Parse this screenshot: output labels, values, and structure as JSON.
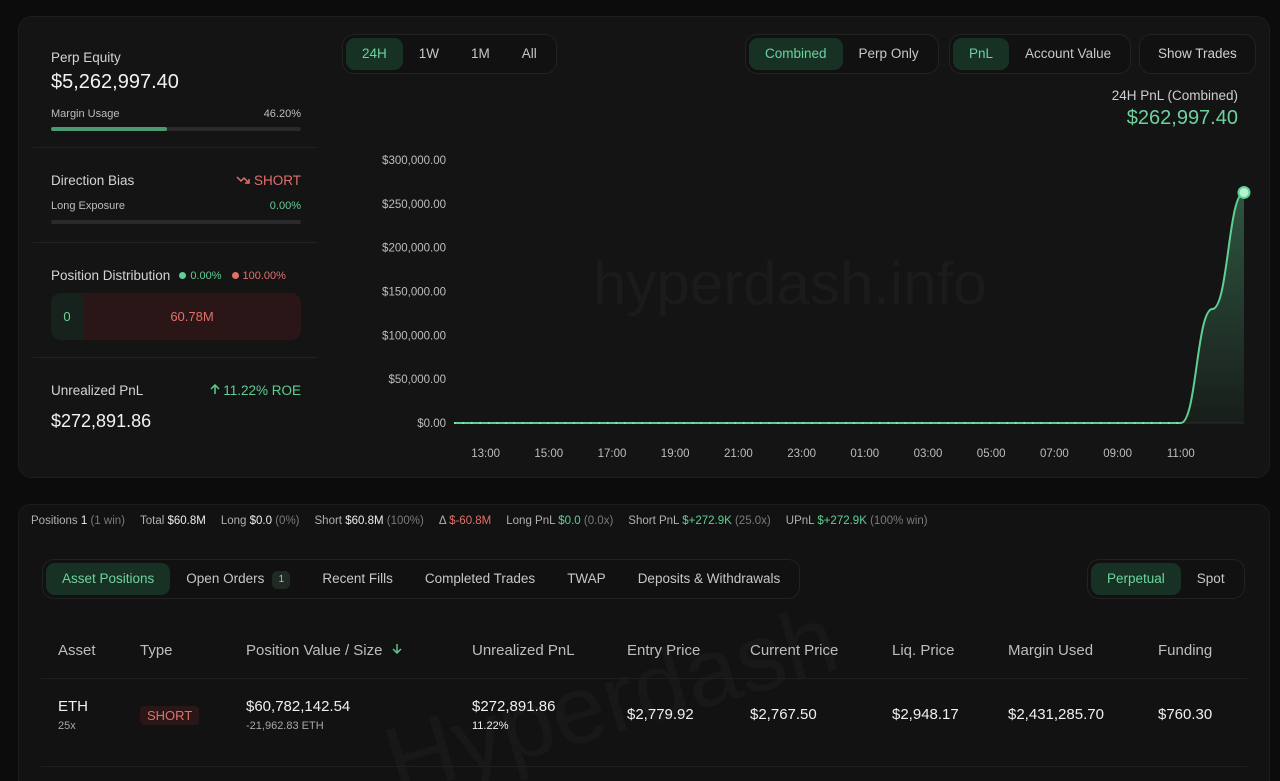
{
  "summary": {
    "perp_equity_label": "Perp Equity",
    "perp_equity_value": "$5,262,997.40",
    "margin_usage_label": "Margin Usage",
    "margin_usage_value": "46.20%",
    "margin_usage_fraction": 0.462,
    "direction_bias_label": "Direction Bias",
    "direction_bias_value": "SHORT",
    "long_exposure_label": "Long Exposure",
    "long_exposure_value": "0.00%",
    "long_exposure_fraction": 0,
    "position_distribution_label": "Position Distribution",
    "dist_long_pct": "0.00%",
    "dist_short_pct": "100.00%",
    "dist_long_value": "0",
    "dist_short_value": "60.78M",
    "unrealized_pnl_label": "Unrealized PnL",
    "roe_value": "11.22% ROE",
    "unrealized_pnl_value": "$272,891.86"
  },
  "controls": {
    "range_tabs": [
      "24H",
      "1W",
      "1M",
      "All"
    ],
    "range_active": "24H",
    "scope_tabs": [
      "Combined",
      "Perp Only"
    ],
    "scope_active": "Combined",
    "metric_tabs": [
      "PnL",
      "Account Value"
    ],
    "metric_active": "PnL",
    "show_trades_label": "Show Trades"
  },
  "chart_header": {
    "label": "24H PnL (Combined)",
    "value": "$262,997.40"
  },
  "watermark": "hyperdash.info",
  "watermark2": "Hyperdash",
  "chart_data": {
    "type": "area",
    "x": [
      "12:00",
      "13:00",
      "14:00",
      "15:00",
      "16:00",
      "17:00",
      "18:00",
      "19:00",
      "20:00",
      "21:00",
      "22:00",
      "23:00",
      "00:00",
      "01:00",
      "02:00",
      "03:00",
      "04:00",
      "05:00",
      "06:00",
      "07:00",
      "08:00",
      "09:00",
      "10:00",
      "11:00",
      "11:30",
      "12:00"
    ],
    "y": [
      0,
      0,
      0,
      0,
      0,
      0,
      0,
      0,
      0,
      0,
      0,
      0,
      0,
      0,
      0,
      0,
      0,
      0,
      0,
      0,
      0,
      0,
      0,
      0,
      130000,
      262997.4
    ],
    "xtick_labels": [
      "13:00",
      "15:00",
      "17:00",
      "19:00",
      "21:00",
      "23:00",
      "01:00",
      "03:00",
      "05:00",
      "07:00",
      "09:00",
      "11:00"
    ],
    "ytick_labels": [
      "$300,000.00",
      "$250,000.00",
      "$200,000.00",
      "$150,000.00",
      "$100,000.00",
      "$50,000.00",
      "$0.00"
    ],
    "ytick_values": [
      300000,
      250000,
      200000,
      150000,
      100000,
      50000,
      0
    ],
    "ylim": [
      0,
      300000
    ],
    "line_color": "#5fcf93",
    "grid": false
  },
  "stats": [
    {
      "label": "Positions",
      "value": "1",
      "muted": "(1 win)",
      "tone": "plain"
    },
    {
      "label": "Total",
      "value": "$60.8M",
      "muted": "",
      "tone": "plain"
    },
    {
      "label": "Long",
      "value": "$0.0",
      "muted": "(0%)",
      "tone": "plain"
    },
    {
      "label": "Short",
      "value": "$60.8M",
      "muted": "(100%)",
      "tone": "plain"
    },
    {
      "label": "Δ",
      "value": "$-60.8M",
      "muted": "",
      "tone": "red"
    },
    {
      "label": "Long PnL",
      "value": "$0.0",
      "muted": "(0.0x)",
      "tone": "green"
    },
    {
      "label": "Short PnL",
      "value": "$+272.9K",
      "muted": "(25.0x)",
      "tone": "green"
    },
    {
      "label": "UPnL",
      "value": "$+272.9K",
      "muted": "(100% win)",
      "tone": "green"
    }
  ],
  "tabs": {
    "items": [
      "Asset Positions",
      "Open Orders",
      "Recent Fills",
      "Completed Trades",
      "TWAP",
      "Deposits & Withdrawals"
    ],
    "active": "Asset Positions",
    "open_orders_count": "1",
    "market_tabs": [
      "Perpetual",
      "Spot"
    ],
    "market_active": "Perpetual"
  },
  "table": {
    "headers": [
      "Asset",
      "Type",
      "Position Value / Size",
      "Unrealized PnL",
      "Entry Price",
      "Current Price",
      "Liq. Price",
      "Margin Used",
      "Funding"
    ],
    "rows": [
      {
        "asset": "ETH",
        "leverage": "25x",
        "type": "SHORT",
        "position_value": "$60,782,142.54",
        "size": "-21,962.83 ETH",
        "upnl": "$272,891.86",
        "upnl_pct": "11.22%",
        "entry_price": "$2,779.92",
        "current_price": "$2,767.50",
        "liq_price": "$2,948.17",
        "margin_used": "$2,431,285.70",
        "funding": "$760.30"
      }
    ]
  }
}
